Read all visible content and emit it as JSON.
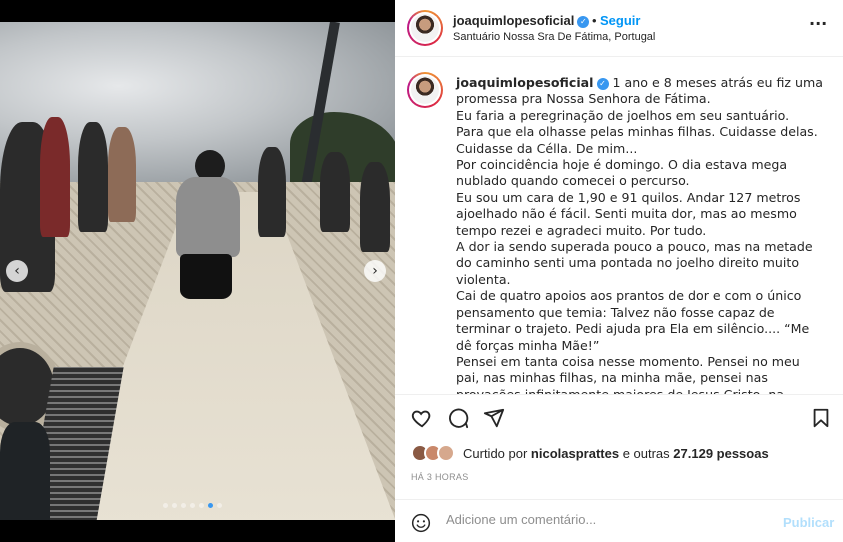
{
  "post": {
    "username": "joaquimlopesoficial",
    "verified_glyph": "✓",
    "separator": "•",
    "follow_label": "Seguir",
    "location": "Santuário Nossa Sra De Fátima, Portugal",
    "more_icon": "more-horizontal-icon",
    "more_glyph": "···"
  },
  "media": {
    "prev_glyph": "‹",
    "next_glyph": "›",
    "slide_count": 7,
    "active_slide": 6
  },
  "caption": {
    "username": "joaquimlopesoficial",
    "lines": [
      "1 ano e 8 meses atrás eu fiz uma promessa pra Nossa Senhora de Fátima.",
      "Eu faria a peregrinação de joelhos em seu santuário.",
      "Para que ela olhasse pelas minhas filhas. Cuidasse delas.",
      "Cuidasse da Célla. De mim...",
      "Por coincidência hoje é domingo. O dia estava mega nublado quando comecei o percurso.",
      "Eu sou um cara de 1,90 e 91 quilos. Andar 127 metros ajoelhado não é fácil. Senti muita dor, mas ao mesmo tempo rezei e agradeci muito. Por tudo.",
      "A dor ia sendo superada pouco a pouco, mas na metade do caminho senti uma pontada no joelho direito muito violenta.",
      "Cai de quatro apoios aos prantos de dor e com o único pensamento que temia: Talvez não fosse capaz de terminar o trajeto. Pedi ajuda pra Ela em silêncio.... “Me dê forças minha Mãe!”",
      "Pensei em tanta coisa nesse momento. Pensei no meu pai, nas minhas filhas, na minha mãe, pensei nas provações infinitamente maiores de Jesus Cristo, na minha esposa"
    ]
  },
  "actions": {
    "icons": [
      "heart-icon",
      "comment-icon",
      "share-icon",
      "bookmark-icon"
    ]
  },
  "likes": {
    "prefix": "Curtido por ",
    "user": "nicolasprattes",
    "middle": " e outras ",
    "count": "27.129",
    "suffix": " pessoas"
  },
  "time_ago": "HÁ 3 HORAS",
  "comment": {
    "placeholder": "Adicione um comentário...",
    "publish_label": "Publicar"
  },
  "colors": {
    "accent": "#0095f6",
    "verified": "#3897f0",
    "publish_disabled": "#b2dffc"
  }
}
